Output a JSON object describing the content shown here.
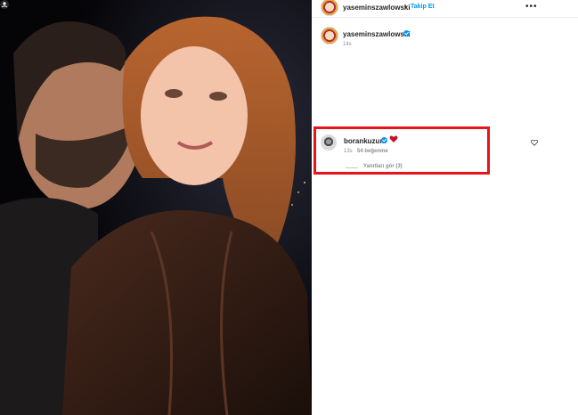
{
  "post": {
    "author": "yaseminszawlowski",
    "separator": "•",
    "follow_label": "Takip Et",
    "more_label": "•••",
    "caption_author": "yaseminszawlowski",
    "caption_time": "14s"
  },
  "comment": {
    "author": "borankuzum",
    "emoji": "heart",
    "time": "13s",
    "likes": "54 beğenme",
    "view_replies": "Yanıtları gör (3)"
  },
  "colors": {
    "accent": "#0095f6",
    "highlight": "#e8141c",
    "heart": "#c8102e"
  }
}
